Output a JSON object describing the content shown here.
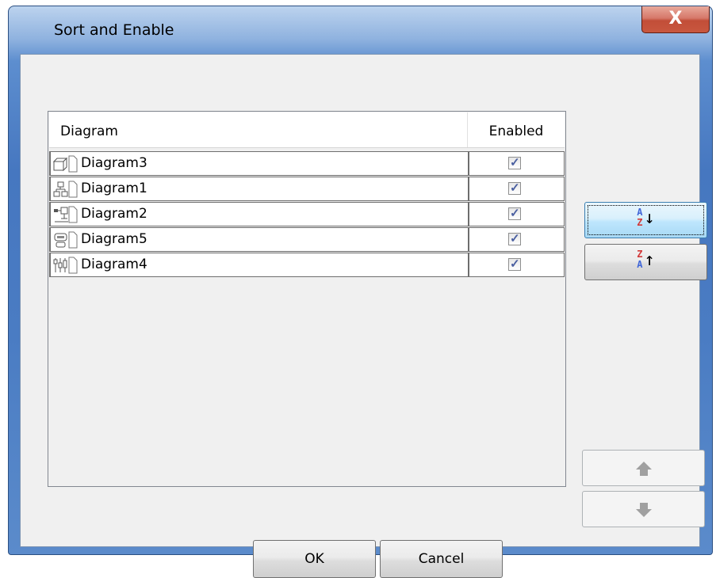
{
  "window": {
    "title": "Sort and Enable",
    "close_glyph": "X"
  },
  "list": {
    "columns": {
      "diagram": "Diagram",
      "enabled": "Enabled"
    },
    "rows": [
      {
        "name": "Diagram3",
        "icon": "class-diagram-icon",
        "enabled": true
      },
      {
        "name": "Diagram1",
        "icon": "hierarchy-diagram-icon",
        "enabled": true
      },
      {
        "name": "Diagram2",
        "icon": "network-diagram-icon",
        "enabled": true
      },
      {
        "name": "Diagram5",
        "icon": "flow-diagram-icon",
        "enabled": true
      },
      {
        "name": "Diagram4",
        "icon": "sequence-diagram-icon",
        "enabled": true
      }
    ]
  },
  "buttons": {
    "sort_ascending": {
      "top": "A",
      "bottom": "Z",
      "arrow": "↓"
    },
    "sort_descending": {
      "top": "Z",
      "bottom": "A",
      "arrow": "↑"
    },
    "ok": "OK",
    "cancel": "Cancel"
  }
}
